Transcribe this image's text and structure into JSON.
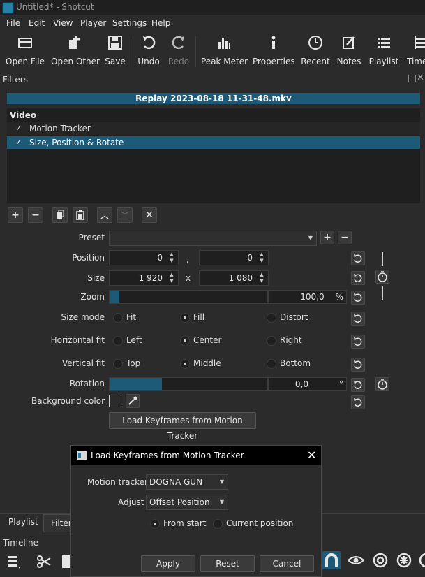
{
  "window": {
    "title": "Untitled* - Shotcut"
  },
  "menu": [
    {
      "label": "File",
      "key": "F",
      "rest": "ile"
    },
    {
      "label": "Edit",
      "key": "E",
      "rest": "dit"
    },
    {
      "label": "View",
      "key": "V",
      "rest": "iew"
    },
    {
      "label": "Player",
      "key": "P",
      "rest": "layer"
    },
    {
      "label": "Settings",
      "key": "S",
      "rest": "ettings"
    },
    {
      "label": "Help",
      "key": "H",
      "rest": "elp"
    }
  ],
  "toolbar": {
    "open_file": "Open File",
    "open_other": "Open Other",
    "save": "Save",
    "undo": "Undo",
    "redo": "Redo",
    "peak_meter": "Peak Meter",
    "properties": "Properties",
    "recent": "Recent",
    "notes": "Notes",
    "playlist": "Playlist",
    "timeline": "Time"
  },
  "filters": {
    "dock_title": "Filters",
    "clip_name": "Replay 2023-08-18 11-31-48.mkv",
    "section": "Video",
    "items": [
      {
        "name": "Motion Tracker",
        "checked": "✓",
        "selected": false
      },
      {
        "name": "Size, Position & Rotate",
        "checked": "✓",
        "selected": true
      }
    ]
  },
  "form": {
    "preset_label": "Preset",
    "preset_value": "",
    "position_label": "Position",
    "position_x": "0",
    "position_sep": ",",
    "position_y": "0",
    "size_label": "Size",
    "size_w": "1 920",
    "size_sep": "x",
    "size_h": "1 080",
    "zoom_label": "Zoom",
    "zoom_value": "100,0",
    "zoom_unit": "%",
    "zoom_fraction": 0.06,
    "size_mode_label": "Size mode",
    "size_mode_options": [
      "Fit",
      "Fill",
      "Distort"
    ],
    "size_mode_selected": "Fill",
    "hfit_label": "Horizontal fit",
    "hfit_options": [
      "Left",
      "Center",
      "Right"
    ],
    "hfit_selected": "Center",
    "vfit_label": "Vertical fit",
    "vfit_options": [
      "Top",
      "Middle",
      "Bottom"
    ],
    "vfit_selected": "Middle",
    "rotation_label": "Rotation",
    "rotation_value": "0,0",
    "rotation_unit": "°",
    "rotation_fraction": 0.33,
    "bg_color_label": "Background color",
    "load_keyframes_button": "Load Keyframes from Motion Tracker"
  },
  "bottom": {
    "tab_playlist": "Playlist",
    "tab_filters": "Filters",
    "timeline_title": "Timeline"
  },
  "dialog": {
    "title": "Load Keyframes from Motion Tracker",
    "motion_tracker_label": "Motion tracker",
    "motion_tracker_value": "DOGNA GUN",
    "adjust_label": "Adjust",
    "adjust_value": "Offset Position",
    "from_start": "From start",
    "current_position": "Current position",
    "mode_selected": "From start",
    "apply": "Apply",
    "reset": "Reset",
    "cancel": "Cancel"
  },
  "colors": {
    "accent": "#1c5a78",
    "background": "#2b2b2b",
    "field": "#1f1f1f"
  }
}
